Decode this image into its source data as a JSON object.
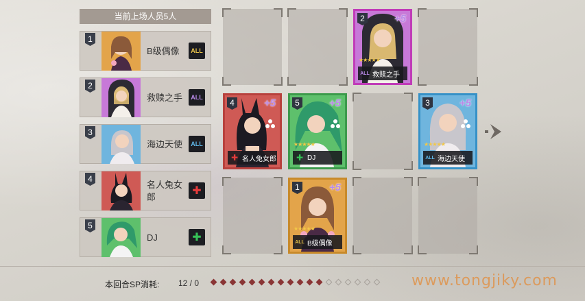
{
  "roster": {
    "header": "当前上场人员5人",
    "members": [
      {
        "pos": "1",
        "name": "B级偶像",
        "class_icon": "all-class-icon",
        "class_text": "ALL",
        "class_color": "#e8c24a"
      },
      {
        "pos": "2",
        "name": "救赎之手",
        "class_icon": "all-class-icon",
        "class_text": "ALL",
        "class_color": "#b98ae8"
      },
      {
        "pos": "3",
        "name": "海边天使",
        "class_icon": "all-class-icon",
        "class_text": "ALL",
        "class_color": "#5fb7e8"
      },
      {
        "pos": "4",
        "name": "名人兔女郎",
        "class_icon": "cross-class-icon",
        "class_text": "✚",
        "class_color": "#e53b3b"
      },
      {
        "pos": "5",
        "name": "DJ",
        "class_icon": "cross-class-icon",
        "class_text": "✚",
        "class_color": "#36c257"
      }
    ]
  },
  "formation": {
    "cards": [
      {
        "pos": "2",
        "name": "救赎之手",
        "plus": "+5",
        "border": "#c03cb8",
        "art": "#c779d8",
        "icon_text": "ALL",
        "icon_color": "#b98ae8",
        "stars": "★★★★★"
      },
      {
        "pos": "4",
        "name": "名人兔女郎",
        "plus": "+5",
        "border": "#b8413d",
        "art": "#cf5a55",
        "icon_text": "✚",
        "icon_color": "#e53b3b",
        "stars": ""
      },
      {
        "pos": "5",
        "name": "DJ",
        "plus": "+5",
        "border": "#3c9a4b",
        "art": "#5ec06c",
        "icon_text": "✚",
        "icon_color": "#36c257",
        "stars": "★★★★★"
      },
      {
        "pos": "3",
        "name": "海边天使",
        "plus": "+5",
        "border": "#3691c7",
        "art": "#6fb5de",
        "icon_text": "ALL",
        "icon_color": "#5fb7e8",
        "stars": "★★★★★"
      },
      {
        "pos": "1",
        "name": "B级偶像",
        "plus": "+5",
        "border": "#c88a2a",
        "art": "#e3a44a",
        "icon_text": "ALL",
        "icon_color": "#e8c24a",
        "stars": "★★★★★"
      }
    ]
  },
  "sp": {
    "label": "本回合SP消耗:",
    "value": "12 / 0",
    "used": 12,
    "total": 18
  },
  "watermark": "www.tongjiky.com"
}
